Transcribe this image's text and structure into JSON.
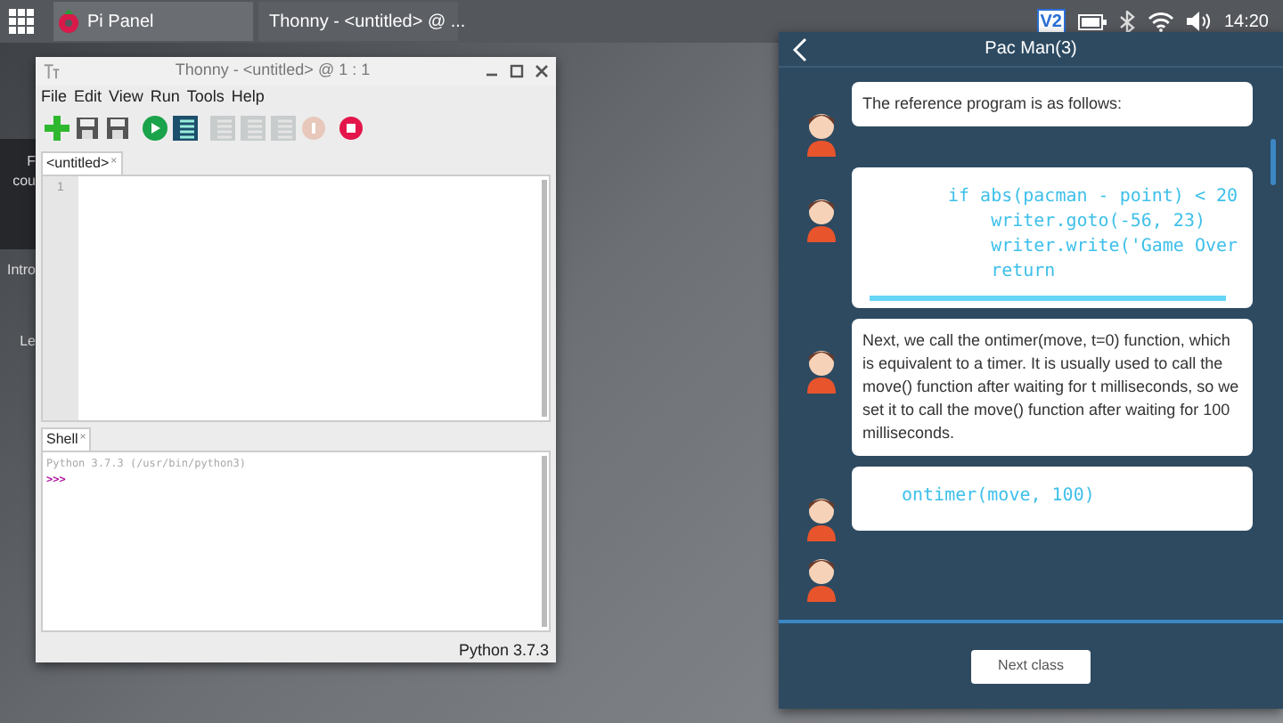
{
  "taskbar": {
    "items": [
      {
        "label": "Pi Panel",
        "kind": "pi",
        "selected": true
      },
      {
        "label": "Thonny - <untitled> @ ...",
        "kind": "thonny",
        "selected": false
      }
    ],
    "clock": "14:20",
    "tray_badge": "V2"
  },
  "background_texts": [
    "F",
    "cou",
    "Intro",
    "Le"
  ],
  "thonny": {
    "title": "Thonny - <untitled> @ 1 : 1",
    "menu": [
      "File",
      "Edit",
      "View",
      "Run",
      "Tools",
      "Help"
    ],
    "toolbar": [
      {
        "kind": "new",
        "disabled": false
      },
      {
        "kind": "load",
        "disabled": false
      },
      {
        "kind": "save",
        "disabled": false
      },
      {
        "kind": "run",
        "disabled": false
      },
      {
        "kind": "debug",
        "disabled": false
      },
      {
        "kind": "step",
        "disabled": true
      },
      {
        "kind": "step",
        "disabled": true
      },
      {
        "kind": "step",
        "disabled": true
      },
      {
        "kind": "resume",
        "disabled": true
      },
      {
        "kind": "stop",
        "disabled": false
      }
    ],
    "editor_tab": {
      "label": "<untitled>",
      "close": "×"
    },
    "line_numbers": [
      "1"
    ],
    "shell_tab": {
      "label": "Shell",
      "close": "×"
    },
    "shell_lines": [
      {
        "kind": "banner",
        "text": "Python 3.7.3 (/usr/bin/python3)"
      },
      {
        "kind": "prompt",
        "text": ">>>"
      }
    ],
    "status": "Python 3.7.3"
  },
  "lesson": {
    "title": "Pac Man(3)",
    "messages": [
      {
        "kind": "text",
        "text": "The reference program is as follows:"
      },
      {
        "kind": "code",
        "lines": [
          "if abs(pacman - point) < 20",
          "    writer.goto(-56, 23)",
          "    writer.write('Game Over",
          "    return"
        ]
      },
      {
        "kind": "text",
        "text": "Next, we call the ontimer(move, t=0) function, which is equivalent to a timer. It is usually used to call the move() function after waiting for t milliseconds, so we set it to call the move() function after waiting for 100 milliseconds."
      },
      {
        "kind": "code",
        "lines": [
          "ontimer(move, 100)"
        ]
      }
    ],
    "next_button": "Next class"
  }
}
